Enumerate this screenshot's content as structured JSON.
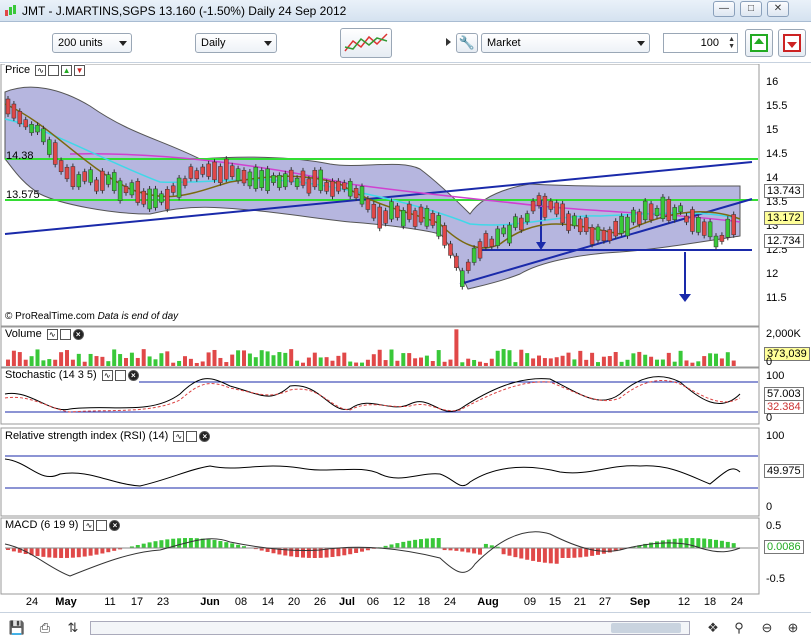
{
  "window": {
    "title": "JMT - J.MARTINS,SGPS    13.160 (-1.50%)    Daily  24 Sep 2012"
  },
  "toolbar": {
    "units": "200 units",
    "period": "Daily",
    "order_type": "Market",
    "quantity": "100"
  },
  "price_panel": {
    "title": "Price",
    "credit": "© ProRealTime.com",
    "credit_note": "Data is end of day",
    "axis_ticks": [
      "16",
      "15.5",
      "15",
      "14.5",
      "14",
      "13.5",
      "13",
      "12.5",
      "12",
      "11.5"
    ],
    "level_labels": [
      "14.38",
      "13.575"
    ],
    "value_boxes": [
      "13.743",
      "13.172",
      "12.734"
    ]
  },
  "volume_panel": {
    "title": "Volume",
    "axis_ticks": [
      "2,000K",
      "0"
    ],
    "value_box": "373,039"
  },
  "stochastic_panel": {
    "title": "Stochastic (14 3 5)",
    "axis_ticks": [
      "100",
      "0"
    ],
    "value_boxes": [
      "57.003",
      "32.384"
    ]
  },
  "rsi_panel": {
    "title": "Relative strength index (RSI) (14)",
    "axis_ticks": [
      "100",
      "0"
    ],
    "value_box": "49.975"
  },
  "macd_panel": {
    "title": "MACD (6 19 9)",
    "axis_ticks": [
      "0.5",
      "-0.5"
    ],
    "value_box": "0.0086"
  },
  "date_axis": [
    "24",
    "May",
    "11",
    "17",
    "23",
    "Jun",
    "08",
    "14",
    "20",
    "26",
    "Jul",
    "06",
    "12",
    "18",
    "24",
    "Aug",
    "09",
    "15",
    "21",
    "27",
    "Sep",
    "12",
    "18",
    "24"
  ],
  "colors": {
    "band_fill": "#8585c9",
    "up_candle": "#39c839",
    "down_candle": "#e04848",
    "level_line": "#33dd33",
    "trend_line": "#1a2aaa",
    "ma_magenta": "#d040d0",
    "ma_cyan": "#40d8e8",
    "ma_olive": "#7a6a10"
  },
  "chart_data": {
    "type": "candlestick",
    "x": [
      "2012-04-24",
      "2012-09-24"
    ],
    "price_range": [
      11.5,
      16
    ],
    "last_close": 13.16,
    "change_pct": -1.5,
    "levels": [
      14.38,
      13.575
    ],
    "indicators": [
      "Volume",
      "Stochastic (14 3 5)",
      "Relative strength index (RSI) (14)",
      "MACD (6 19 9)"
    ]
  }
}
